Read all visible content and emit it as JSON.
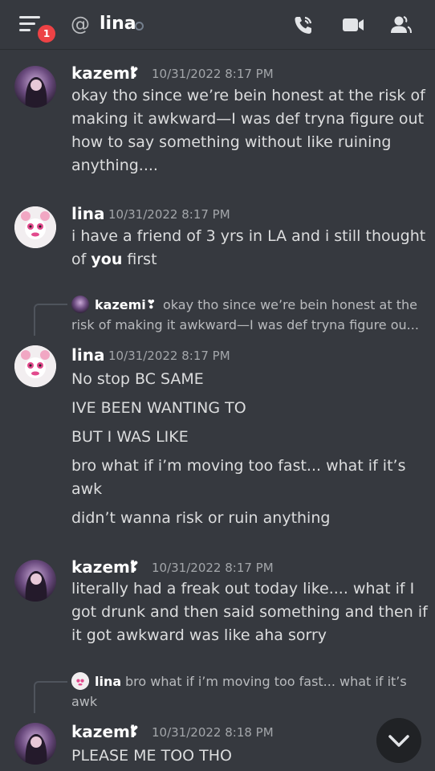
{
  "header": {
    "channel_prefix": "@",
    "channel_name": "lina",
    "notification_count": "1",
    "icons": [
      "menu-icon",
      "call-icon",
      "video-icon",
      "members-icon"
    ]
  },
  "messages": [
    {
      "author": "kazemi",
      "timestamp": "10/31/2022 8:17 PM",
      "lines": [
        "okay tho since we’re bein honest at the risk of",
        "making it awkward—I was def tryna figure out",
        "how to say something without like ruining",
        "anything...."
      ]
    },
    {
      "author": "lina",
      "timestamp": "10/31/2022 8:17 PM",
      "lines": [
        "i have a friend of 3 yrs in LA and i still thought",
        "first"
      ],
      "bold_word": "you",
      "line2_prefix": "of"
    },
    {
      "reply": {
        "author": "kazemi",
        "text_line1": "okay tho since we’re bein honest at the",
        "text_line2": "risk of making it awkward—I was def tryna figure ou..."
      },
      "author": "lina",
      "timestamp": "10/31/2022 8:17 PM",
      "lines": [
        "No stop BC SAME",
        "IVE BEEN WANTING TO",
        "BUT I WAS LIKE",
        "bro what if i’m moving too fast... what if it’s",
        "awk",
        "didn’t wanna risk or ruin anything"
      ]
    },
    {
      "author": "kazemi",
      "timestamp": "10/31/2022 8:17 PM",
      "lines": [
        "literally had a freak out today like.... what if I",
        "got drunk and then said something and then if",
        "it got awkward was like aha sorry"
      ]
    },
    {
      "reply": {
        "author": "lina",
        "text_line1": "bro what if i’m moving too fast... what if it’s",
        "text_line2": "awk"
      },
      "author": "kazemi",
      "timestamp": "10/31/2022 8:18 PM",
      "lines": [
        "PLEASE ME TOO THO"
      ]
    }
  ],
  "heart_glyph": "❣"
}
